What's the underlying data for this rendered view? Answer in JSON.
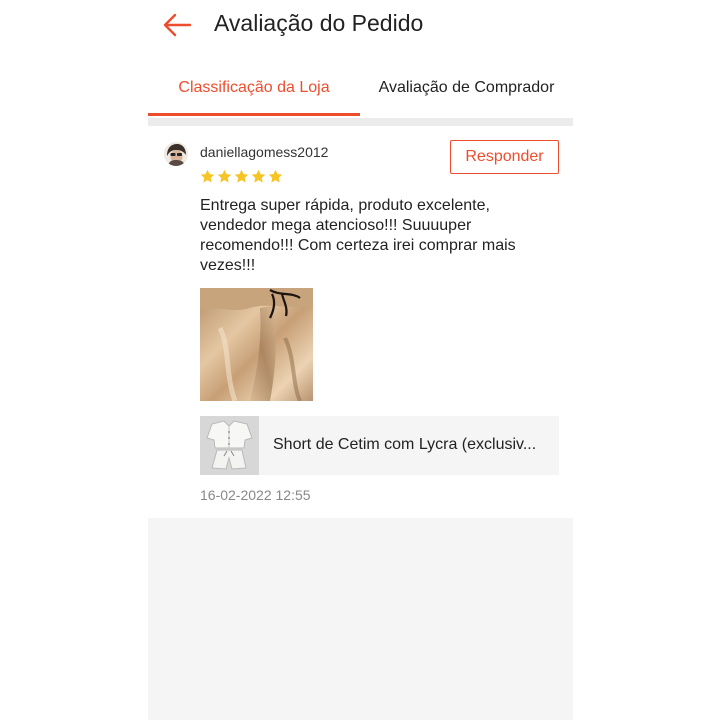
{
  "header": {
    "title": "Avaliação do Pedido",
    "back_icon": "arrow-left-icon"
  },
  "tabs": [
    {
      "label": "Classificação da Loja",
      "active": true
    },
    {
      "label": "Avaliação de Comprador",
      "active": false
    }
  ],
  "review": {
    "username": "daniellagomess2012",
    "rating": 5,
    "rating_max": 5,
    "reply_label": "Responder",
    "comment": "Entrega super rápida, produto excelente, vendedor mega atencioso!!! Suuuuper recomendo!!! Com certeza irei comprar mais vezes!!!",
    "product_name": "Short de Cetim com Lycra (exclusiv...",
    "date": "16-02-2022 12:55"
  },
  "colors": {
    "accent": "#ee4d2d",
    "star": "#f6c425",
    "separator": "#ebebeb",
    "background_empty": "#f5f5f5",
    "muted_text": "#888888"
  }
}
